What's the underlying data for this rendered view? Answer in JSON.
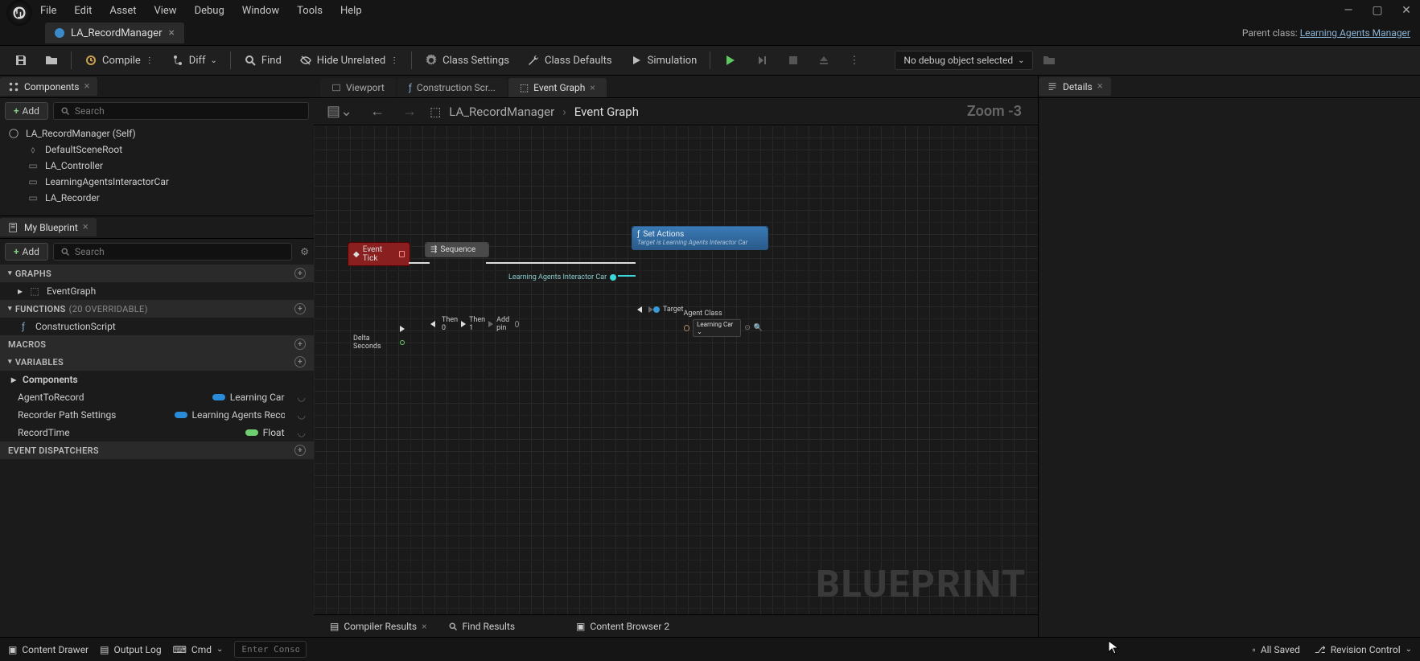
{
  "menu": {
    "file": "File",
    "edit": "Edit",
    "asset": "Asset",
    "view": "View",
    "debug": "Debug",
    "window": "Window",
    "tools": "Tools",
    "help": "Help"
  },
  "file_tab": {
    "name": "LA_RecordManager"
  },
  "parent_class": {
    "label": "Parent class:",
    "value": "Learning Agents Manager"
  },
  "toolbar": {
    "compile": "Compile",
    "diff": "Diff",
    "find": "Find",
    "hide": "Hide Unrelated",
    "class_settings": "Class Settings",
    "class_defaults": "Class Defaults",
    "simulation": "Simulation",
    "debug_select": "No debug object selected"
  },
  "components_panel": {
    "title": "Components",
    "add": "Add",
    "search_placeholder": "Search",
    "root": "LA_RecordManager (Self)",
    "items": [
      "DefaultSceneRoot",
      "LA_Controller",
      "LearningAgentsInteractorCar",
      "LA_Recorder"
    ]
  },
  "mybp": {
    "title": "My Blueprint",
    "add": "Add",
    "search_placeholder": "Search",
    "graphs": "GRAPHS",
    "eventgraph": "EventGraph",
    "functions": "FUNCTIONS",
    "functions_sub": "(20 OVERRIDABLE)",
    "construction": "ConstructionScript",
    "macros": "MACROS",
    "variables": "VARIABLES",
    "components": "Components",
    "vars": [
      {
        "name": "AgentToRecord",
        "type": "Learning Car",
        "color": "blue"
      },
      {
        "name": "Recorder Path Settings",
        "type": "Learning Agents Recor",
        "color": "blue"
      },
      {
        "name": "RecordTime",
        "type": "Float",
        "color": "green"
      }
    ],
    "dispatchers": "EVENT DISPATCHERS"
  },
  "center_tabs": {
    "viewport": "Viewport",
    "construction": "Construction Scr...",
    "eventgraph": "Event Graph"
  },
  "breadcrumb": {
    "asset": "LA_RecordManager",
    "graph": "Event Graph",
    "zoom": "Zoom -3"
  },
  "graph": {
    "watermark": "BLUEPRINT",
    "event_tick": "Event Tick",
    "delta": "Delta Seconds",
    "sequence": "Sequence",
    "then0": "Then 0",
    "then1": "Then 1",
    "addpin": "Add pin",
    "ref": "Learning Agents Interactor Car",
    "set_actions": "Set Actions",
    "set_sub": "Target is Learning Agents Interactor Car",
    "target": "Target",
    "agent_class": "Agent Class",
    "agent_class_val": "Learning Car"
  },
  "details": {
    "title": "Details"
  },
  "bottom_tabs": {
    "compiler": "Compiler Results",
    "find": "Find Results",
    "content": "Content Browser 2"
  },
  "statusbar": {
    "drawer": "Content Drawer",
    "output": "Output Log",
    "cmd": "Cmd",
    "cmd_placeholder": "Enter Console C",
    "saved": "All Saved",
    "revision": "Revision Control"
  }
}
